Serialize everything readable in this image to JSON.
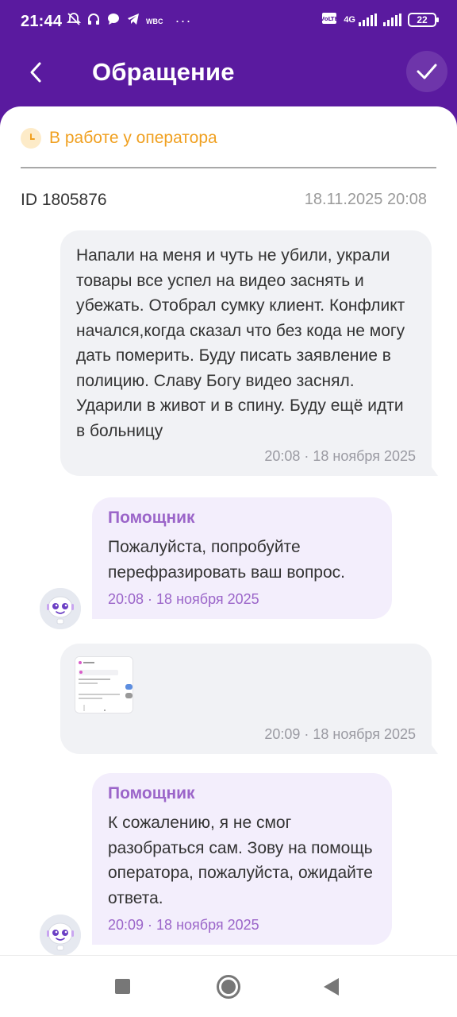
{
  "status_bar": {
    "time": "21:44",
    "icons": [
      "dnd-icon",
      "headphones-icon",
      "chat-icon",
      "telegram-icon",
      "wbc-icon",
      "more-dots-icon"
    ],
    "wbc_label": "WBC",
    "dots": "···",
    "network_label": "4G",
    "battery": "22"
  },
  "header": {
    "title": "Обращение",
    "back_icon": "chevron-left-icon",
    "confirm_icon": "check-icon"
  },
  "ticket": {
    "status": "В работе у оператора",
    "status_color": "#f0a020",
    "id_label": "ID 1805876",
    "date": "18.11.2025 20:08"
  },
  "messages": [
    {
      "type": "user",
      "text": "Напали на меня и чуть не убили, украли товары все успел на видео заснять и убежать. Отобрал сумку клиент. Конфликт начался,когда сказал что без кода не могу дать померить. Буду писать заявление в полицию. Славу Богу видео заснял. Ударили в живот и в спину. Буду ещё идти в больницу",
      "time": "20:08 · 18 ноября 2025"
    },
    {
      "type": "bot",
      "sender": "Помощник",
      "text": "Пожалуйста, попробуйте перефразировать ваш вопрос.",
      "time": "20:08 · 18 ноября 2025"
    },
    {
      "type": "user-attachment",
      "time": "20:09 · 18 ноября 2025"
    },
    {
      "type": "bot",
      "sender": "Помощник",
      "text": "К сожалению, я не смог разобраться сам. Зову на помощь оператора, пожалуйста, ожидайте ответа.",
      "time": "20:09 · 18 ноября 2025"
    }
  ],
  "colors": {
    "header_bg": "#5a1a9f",
    "bot_accent": "#9b65c9",
    "user_bubble": "#f1f2f5",
    "bot_bubble": "#f3eefc"
  }
}
